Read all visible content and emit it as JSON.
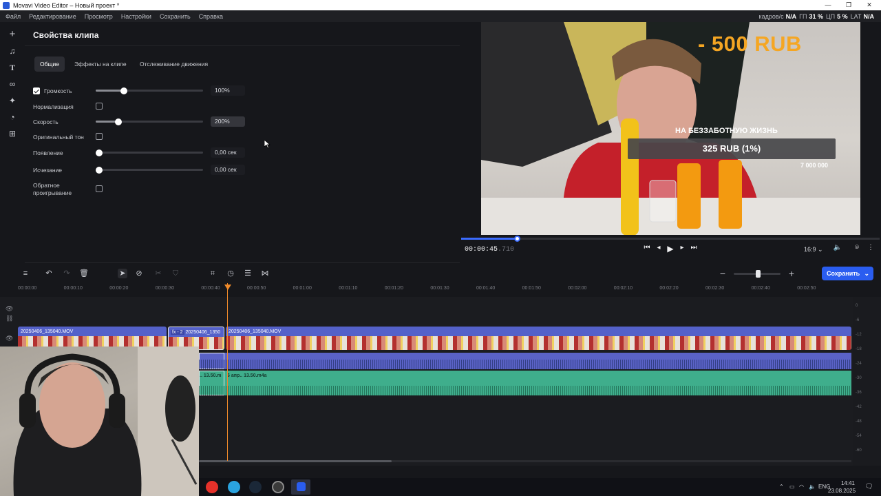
{
  "window": {
    "title": "Movavi Video Editor – Новый проект *"
  },
  "menu": {
    "items": [
      "Файл",
      "Редактирование",
      "Просмотр",
      "Настройки",
      "Сохранить",
      "Справка"
    ],
    "stats": [
      {
        "label": "кадров/с",
        "value": "N/A"
      },
      {
        "label": "ГП",
        "value": "31 %"
      },
      {
        "label": "ЦП",
        "value": "5 %"
      },
      {
        "label": "LAT",
        "value": "N/A"
      }
    ]
  },
  "properties": {
    "title": "Свойства клипа",
    "tabs": [
      "Общие",
      "Эффекты на клипе",
      "Отслеживание движения"
    ],
    "volume": {
      "label": "Громкость",
      "value": "100%",
      "level": 0.26,
      "checked": true
    },
    "normalization": {
      "label": "Нормализация"
    },
    "speed": {
      "label": "Скорость",
      "value": "200%",
      "level": 0.21
    },
    "original_tone": {
      "label": "Оригинальный тон"
    },
    "fade_in": {
      "label": "Появление",
      "value": "0,00 сек"
    },
    "fade_out": {
      "label": "Исчезание",
      "value": "0,00 сек"
    },
    "reverse": {
      "label": "Обратное проигрывание"
    }
  },
  "preview": {
    "overlay_price": "- 500 RUB",
    "overlay_caption": "НА БЕЗЗАБОТНУЮ ЖИЗНЬ",
    "overlay_box": "325 RUB (1%)",
    "overlay_goal": "7 000 000",
    "progress": 0.13,
    "timecode_main": "00:00:45",
    "timecode_frac": ".710",
    "aspect": "16:9"
  },
  "timeline": {
    "save_label": "Сохранить",
    "ruler": [
      "00:00:00",
      "00:00:10",
      "00:00:20",
      "00:00:30",
      "00:00:40",
      "00:00:50",
      "00:01:00",
      "00:01:10",
      "00:01:20",
      "00:01:30",
      "00:01:40",
      "00:01:50",
      "00:02:00",
      "00:02:10",
      "00:02:20",
      "00:02:30",
      "00:02:40",
      "00:02:50"
    ],
    "clip1": "20250406_135040.MOV",
    "clip2_fx": "fx - 2",
    "clip2": "20250406_1350",
    "clip3": "20250406_135040.MOV",
    "audio_a": ".. 13.50.m",
    "audio_b": "6 апр.. 13.50.m4a",
    "meter_ticks": [
      "0",
      "-6",
      "-12",
      "-18",
      "-24",
      "-30",
      "-36",
      "-42",
      "-48",
      "-54",
      "-60"
    ]
  },
  "taskbar": {
    "lang": "ENG",
    "time": "14:41",
    "date": "23.08.2025"
  },
  "colors": {
    "accent": "#2a5df0",
    "playhead": "#f08a2a",
    "video_clip": "#5461c9",
    "audio_clip": "#3fae8c"
  }
}
